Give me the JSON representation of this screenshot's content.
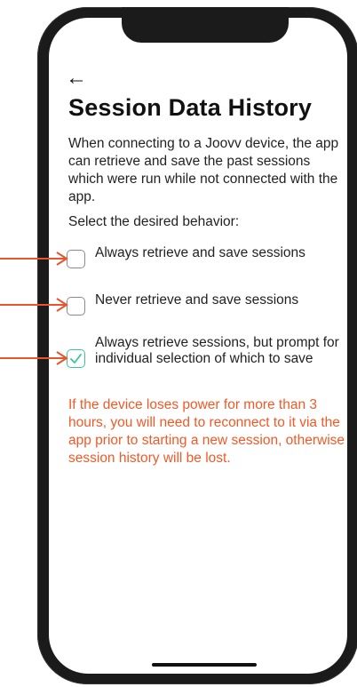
{
  "header": {
    "back_icon": "arrow-left-icon",
    "title": "Session Data History"
  },
  "content": {
    "intro": "When connecting to a Joovv device, the app can retrieve and save the past sessions which were run while not connected with the app.",
    "prompt": "Select the desired behavior:",
    "options": [
      {
        "label": "Always retrieve and save sessions",
        "checked": false
      },
      {
        "label": "Never retrieve and save sessions",
        "checked": false
      },
      {
        "label": "Always retrieve sessions, but prompt for individual selection of which to save",
        "checked": true
      }
    ],
    "warning": "If the device loses power for more than 3 hours, you will need to reconnect to it via the app prior to starting a new session, otherwise session history will be lost."
  },
  "colors": {
    "accent_check": "#3dc59a",
    "warning": "#f05a28",
    "annotation_arrow": "#e8542c"
  }
}
